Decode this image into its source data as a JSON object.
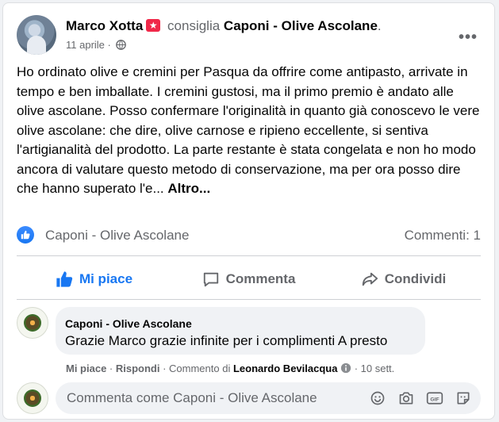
{
  "post": {
    "author": "Marco Xotta",
    "badge_glyph": "★",
    "verb": "consiglia",
    "page": "Caponi - Olive Ascolane",
    "page_suffix": ".",
    "date": "11 aprile",
    "date_sep": "·",
    "more_glyph": "•••",
    "text": "Ho ordinato olive e cremini per Pasqua da offrire come antipasto, arrivate in tempo e ben imballate. I cremini gustosi, ma il primo premio è andato alle olive ascolane. Posso confermare l'originalità in quanto già conoscevo le vere olive ascolane: che dire, olive carnose e ripieno eccellente, si sentiva l'artigianalità del prodotto. La parte restante è stata congelata e non ho modo ancora di valutare questo metodo di conservazione, ma per ora posso dire che hanno superato l'e...",
    "see_more": "Altro..."
  },
  "stats": {
    "reactor": "Caponi - Olive Ascolane",
    "comments": "Commenti: 1"
  },
  "actions": {
    "like": "Mi piace",
    "comment": "Commenta",
    "share": "Condividi"
  },
  "comment": {
    "author": "Caponi - Olive Ascolane",
    "text": "Grazie Marco grazie infinite per i complimenti A presto",
    "like": "Mi piace",
    "reply": "Rispondi",
    "sep1": " · ",
    "sep2": " · ",
    "edited_by_prefix": "Commento di",
    "editor": "Leonardo Bevilacqua",
    "sep3": " · ",
    "time": "10 sett."
  },
  "composer": {
    "placeholder": "Commenta come Caponi - Olive Ascolane"
  },
  "colors": {
    "accent": "#1877f2",
    "badge": "#f02849",
    "muted": "#65676b"
  }
}
